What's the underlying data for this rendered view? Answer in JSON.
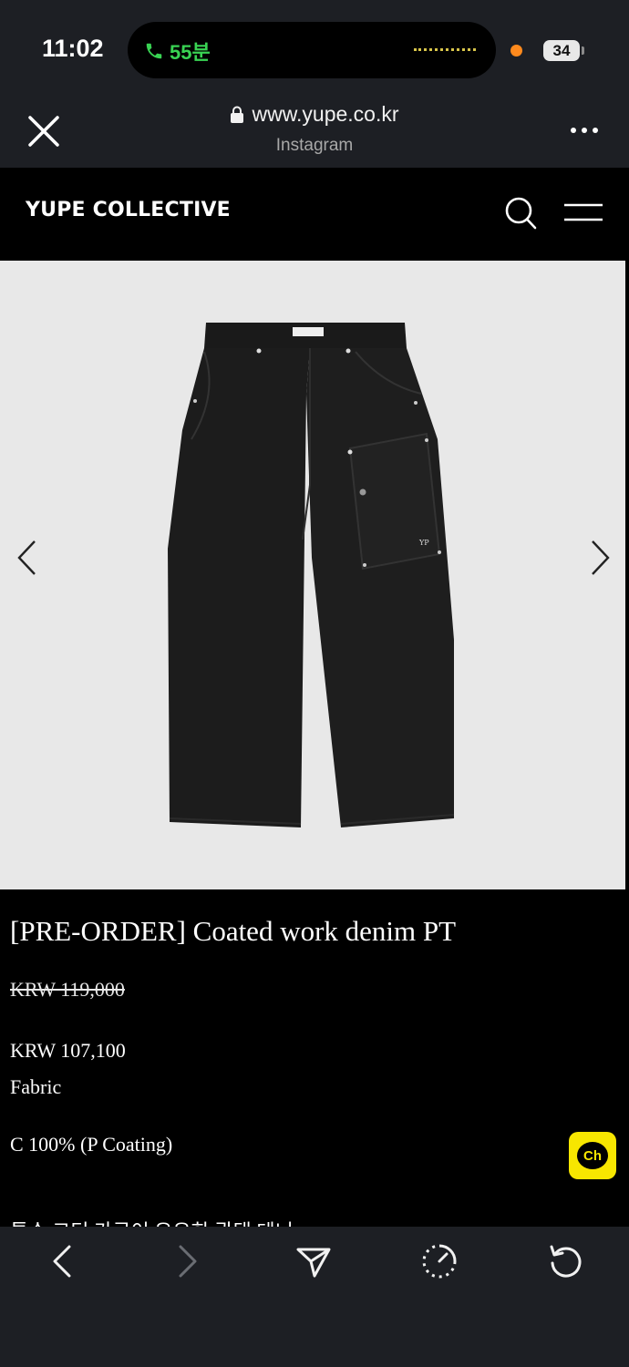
{
  "status_bar": {
    "time": "11:02",
    "call_duration": "55분",
    "battery_level": "34",
    "icons": [
      "phone-icon",
      "recording-dot",
      "battery-icon"
    ]
  },
  "browser": {
    "url": "www.yupe.co.kr",
    "source": "Instagram",
    "icons": [
      "close-icon",
      "lock-icon",
      "more-icon"
    ]
  },
  "site": {
    "logo": "YUPE COLLECTIVE",
    "icons": [
      "search-icon",
      "hamburger-menu-icon"
    ]
  },
  "product": {
    "image": "black-pants-product-photo",
    "title": "[PRE-ORDER] Coated work denim PT",
    "original_price": "KRW 119,000",
    "sale_price": "KRW 107,100",
    "fabric_label": "Fabric",
    "fabric_value": "C 100% (P Coating)",
    "description_partial": "특수 코팅 가공이 우유한 광택 데니",
    "chat_label": "Ch"
  },
  "toolbar": {
    "icons": [
      "back-icon",
      "forward-icon",
      "share-icon",
      "speed-icon",
      "reload-icon"
    ]
  },
  "colors": {
    "chrome_bg": "#1d1f24",
    "page_bg": "#000000",
    "image_bg": "#e8e8e8",
    "call_green": "#39d353",
    "kakao_yellow": "#f7e600"
  }
}
